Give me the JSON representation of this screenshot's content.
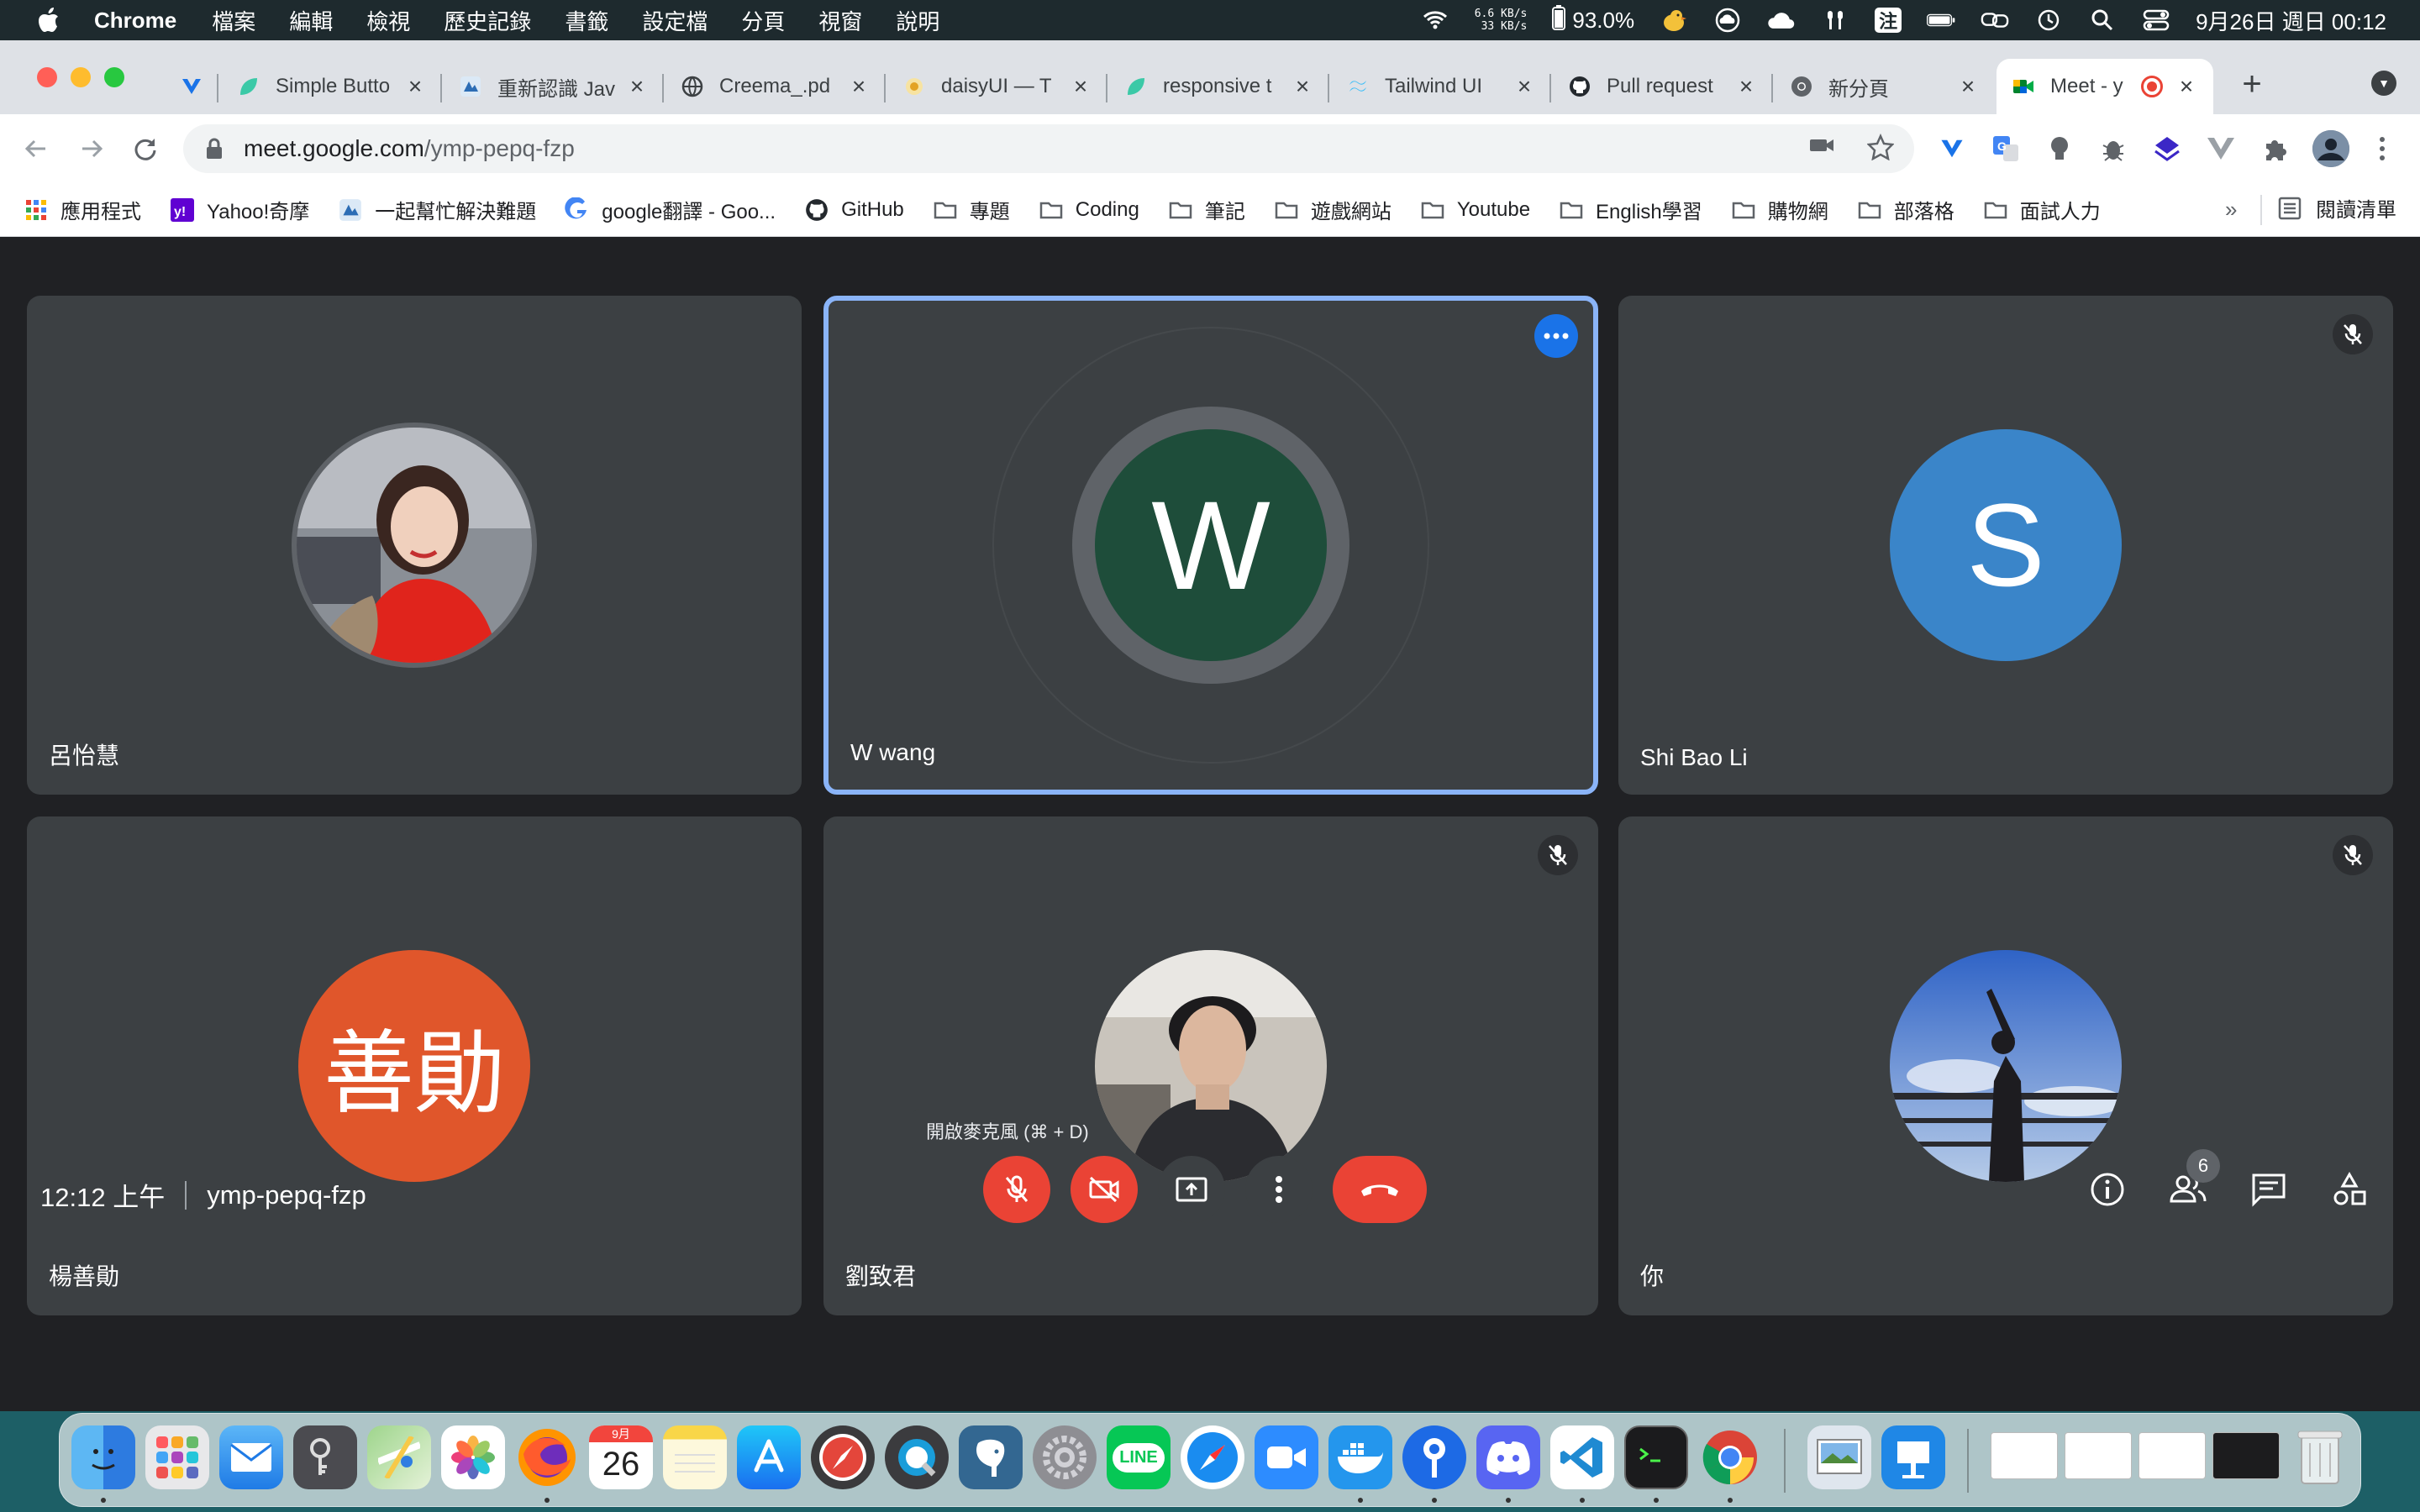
{
  "menubar": {
    "app_name": "Chrome",
    "items": [
      "檔案",
      "編輯",
      "檢視",
      "歷史記錄",
      "書籤",
      "設定檔",
      "分頁",
      "視窗",
      "說明"
    ],
    "net_up": "6.6 KB/s",
    "net_down": "33 KB/s",
    "battery": "93.0%",
    "input_method": "注",
    "datetime": "9月26日 週日 00:12"
  },
  "tabs": [
    {
      "label": "",
      "icon": "vivaldi-y-icon"
    },
    {
      "label": "Simple Butto",
      "icon": "leaf-icon"
    },
    {
      "label": "重新認識 Jav",
      "icon": "ithome-icon"
    },
    {
      "label": "Creema_.pd",
      "icon": "globe-icon"
    },
    {
      "label": "daisyUI — T",
      "icon": "daisy-icon"
    },
    {
      "label": "responsive t",
      "icon": "leaf-icon"
    },
    {
      "label": "Tailwind UI",
      "icon": "tailwind-icon"
    },
    {
      "label": "Pull request",
      "icon": "github-icon"
    },
    {
      "label": "新分頁",
      "icon": "chrome-icon"
    },
    {
      "label": "Meet - y",
      "icon": "meet-icon",
      "active": true
    }
  ],
  "omnibox": {
    "domain": "meet.google.com",
    "path": "/ymp-pepq-fzp"
  },
  "bookmarks": [
    {
      "label": "應用程式",
      "icon": "apps-grid-icon"
    },
    {
      "label": "Yahoo!奇摩",
      "icon": "yahoo-icon"
    },
    {
      "label": "一起幫忙解決難題",
      "icon": "ithome-icon"
    },
    {
      "label": "google翻譯 - Goo...",
      "icon": "google-icon"
    },
    {
      "label": "GitHub",
      "icon": "github-icon"
    },
    {
      "label": "專題",
      "icon": "folder-icon"
    },
    {
      "label": "Coding",
      "icon": "folder-icon"
    },
    {
      "label": "筆記",
      "icon": "folder-icon"
    },
    {
      "label": "遊戲網站",
      "icon": "folder-icon"
    },
    {
      "label": "Youtube",
      "icon": "folder-icon"
    },
    {
      "label": "English學習",
      "icon": "folder-icon"
    },
    {
      "label": "購物網",
      "icon": "folder-icon"
    },
    {
      "label": "部落格",
      "icon": "folder-icon"
    },
    {
      "label": "面試人力",
      "icon": "folder-icon"
    }
  ],
  "bookmarks_more": "»",
  "reading_list": "閱讀清單",
  "participants": [
    {
      "name": "呂怡慧",
      "avatar": "photo-woman-red-sweater",
      "muted": false,
      "speaking": false
    },
    {
      "name": "W wang",
      "initial": "W",
      "avatar_color": "#1e4d3a",
      "muted": false,
      "speaking": true
    },
    {
      "name": "Shi Bao Li",
      "initial": "S",
      "avatar_color": "#3a85c9",
      "muted": true,
      "speaking": false
    },
    {
      "name": "楊善勛",
      "initial": "善勛",
      "avatar_color": "#e0562b",
      "muted": false,
      "speaking": false
    },
    {
      "name": "劉致君",
      "avatar": "photo-man-in-car",
      "muted": true,
      "speaking": false
    },
    {
      "name": "你",
      "avatar": "photo-person-railing-sky",
      "muted": true,
      "speaking": false
    }
  ],
  "tooltip": "開啟麥克風 (⌘ + D)",
  "meeting": {
    "time": "12:12 上午",
    "code": "ymp-pepq-fzp",
    "people_count": "6"
  },
  "dock": [
    "finder",
    "launchpad",
    "mail",
    "keychain",
    "maps",
    "photos",
    "firefox",
    "calendar",
    "notes",
    "app-store",
    "safari-tech",
    "quicktime",
    "postgres",
    "system-prefs",
    "line",
    "safari",
    "zoom",
    "docker",
    "sourcetree",
    "discord",
    "vscode",
    "terminal",
    "chrome",
    "preview",
    "keynote"
  ],
  "dock_calendar": {
    "month": "9月",
    "day": "26"
  },
  "dock_line_label": "LINE"
}
